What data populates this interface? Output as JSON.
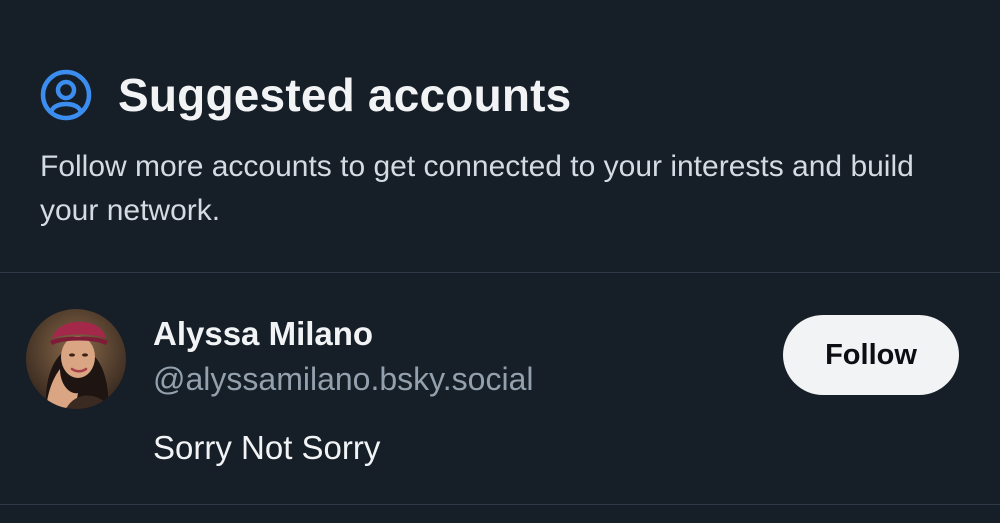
{
  "section": {
    "icon": "user-circle-icon",
    "title": "Suggested accounts",
    "subtitle": "Follow more accounts to get connected to your interests and build your network.",
    "accent_color": "#3b8ef0"
  },
  "accounts": [
    {
      "name": "Alyssa Milano",
      "handle": "@alyssamilano.bsky.social",
      "bio": "Sorry Not Sorry",
      "follow_label": "Follow"
    }
  ]
}
